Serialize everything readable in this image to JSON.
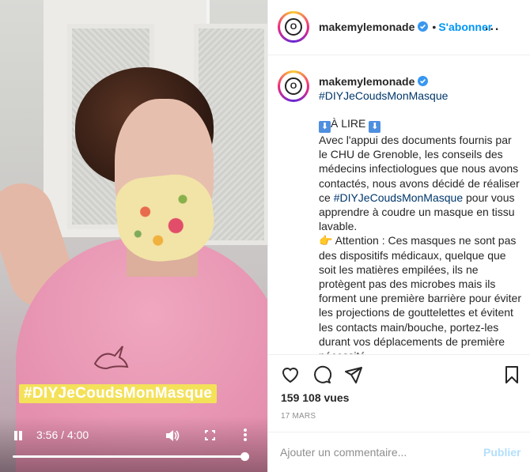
{
  "video": {
    "hashtag_overlay": "#DIYJeCoudsMonMasque",
    "timecode": "3:56 / 4:00",
    "progress": 0.983
  },
  "header": {
    "username": "makemylemonade",
    "separator": "•",
    "follow_label": "S'abonner",
    "more_label": "..."
  },
  "caption": {
    "username": "makemylemonade",
    "hashtag": "#DIYJeCoudsMonMasque",
    "read_arrow": "⬇",
    "read_label": "À LIRE",
    "paragraph1_a": "Avec l'appui des documents fournis par le CHU de Grenoble, les conseils des médecins infectiologues que nous avons contactés, nous avons décidé de réaliser ce ",
    "paragraph1_link": "#DIYJeCoudsMonMasque",
    "paragraph1_b": " pour vous apprendre à coudre un masque en tissu lavable.",
    "pointer_emoji": "👉",
    "paragraph2": "Attention : Ces masques ne sont pas des dispositifs médicaux, quelque que soit les matières empilées, ils ne protègent pas des microbes mais ils forment une première barrière pour éviter les projections de gouttelettes et évitent les contacts main/bouche, portez-les durant vos déplacements de première nécessité"
  },
  "stats": {
    "views": "159 108 vues",
    "date": "17 MARS"
  },
  "comment": {
    "placeholder": "Ajouter un commentaire...",
    "publish_label": "Publier"
  },
  "colors": {
    "accent": "#0095f6",
    "hashtag_link": "#00376b",
    "publish_disabled": "#b2dffc",
    "banner": "#f4e15a"
  },
  "icons": {
    "avatar_logo": "O"
  }
}
